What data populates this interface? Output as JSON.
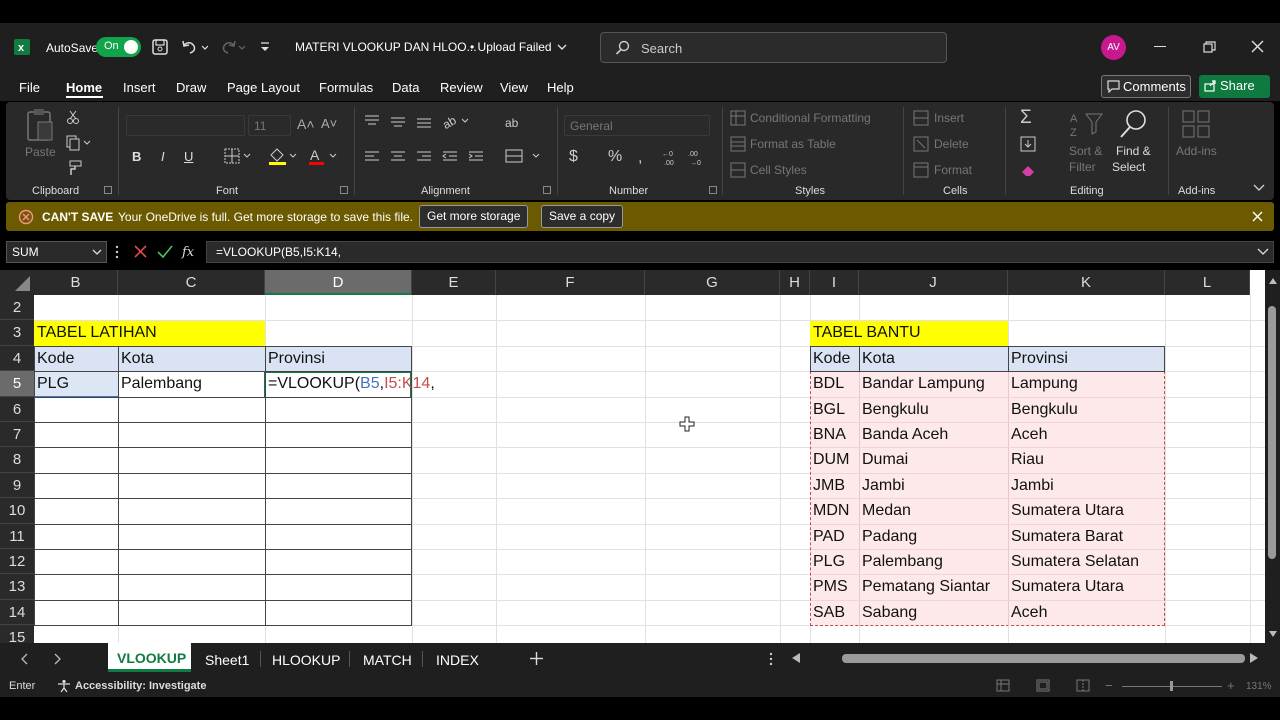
{
  "titlebar": {
    "autosave_label": "AutoSave",
    "toggle_label": "On",
    "document_title": "MATERI VLOOKUP DAN HLOO...",
    "upload_status": "• Upload Failed",
    "search_placeholder": "Search",
    "avatar_initials": "AV"
  },
  "menu": {
    "items": [
      "File",
      "Home",
      "Insert",
      "Draw",
      "Page Layout",
      "Formulas",
      "Data",
      "Review",
      "View",
      "Help"
    ],
    "comments_label": "Comments",
    "share_label": "Share"
  },
  "ribbon": {
    "clipboard": {
      "paste": "Paste",
      "label": "Clipboard"
    },
    "font": {
      "size": "11",
      "label": "Font",
      "bold": "B",
      "italic": "I",
      "underline": "U"
    },
    "alignment": {
      "label": "Alignment"
    },
    "number": {
      "format": "General",
      "label": "Number",
      "currency": "$",
      "percent": "%"
    },
    "styles": {
      "conditional": "Conditional Formatting",
      "table": "Format as Table",
      "cell": "Cell Styles",
      "label": "Styles"
    },
    "cells": {
      "insert": "Insert",
      "delete": "Delete",
      "format": "Format",
      "label": "Cells"
    },
    "editing": {
      "sort_line1": "Sort &",
      "sort_line2": "Filter",
      "find_line1": "Find &",
      "find_line2": "Select",
      "label": "Editing"
    },
    "addins": {
      "label": "Add-ins",
      "button": "Add-ins"
    }
  },
  "message_bar": {
    "title": "CAN'T SAVE",
    "text": "Your OneDrive is full. Get more storage to save this file.",
    "btn_storage": "Get more storage",
    "btn_copy": "Save a copy"
  },
  "formula_bar": {
    "name_box": "SUM",
    "formula": "=VLOOKUP(B5,I5:K14,"
  },
  "grid": {
    "columns": [
      "B",
      "C",
      "D",
      "E",
      "F",
      "G",
      "H",
      "I",
      "J",
      "K",
      "L"
    ],
    "rows": [
      "2",
      "3",
      "4",
      "5",
      "6",
      "7",
      "8",
      "9",
      "10",
      "11",
      "12",
      "13",
      "14",
      "15"
    ],
    "latihan": {
      "title": "TABEL LATIHAN",
      "headers": [
        "Kode",
        "Kota",
        "Provinsi"
      ],
      "row5": [
        "PLG",
        "Palembang"
      ],
      "formula_prefix": "=VLOOKUP(",
      "formula_ref1": "B5",
      "formula_comma1": ",",
      "formula_ref2": "I5:K14",
      "formula_comma2": ","
    },
    "bantu": {
      "title": "TABEL BANTU",
      "headers": [
        "Kode",
        "Kota",
        "Provinsi"
      ],
      "rows": [
        [
          "BDL",
          "Bandar Lampung",
          "Lampung"
        ],
        [
          "BGL",
          "Bengkulu",
          "Bengkulu"
        ],
        [
          "BNA",
          "Banda Aceh",
          "Aceh"
        ],
        [
          "DUM",
          "Dumai",
          "Riau"
        ],
        [
          "JMB",
          "Jambi",
          "Jambi"
        ],
        [
          "MDN",
          "Medan",
          "Sumatera Utara"
        ],
        [
          "PAD",
          "Padang",
          "Sumatera Barat"
        ],
        [
          "PLG",
          "Palembang",
          "Sumatera Selatan"
        ],
        [
          "PMS",
          "Pematang Siantar",
          "Sumatera Utara"
        ],
        [
          "SAB",
          "Sabang",
          "Aceh"
        ]
      ]
    }
  },
  "sheet_tabs": [
    "VLOOKUP",
    "Sheet1",
    "HLOOKUP",
    "MATCH",
    "INDEX"
  ],
  "status": {
    "mode": "Enter",
    "accessibility": "Accessibility: Investigate",
    "zoom": "131%"
  },
  "colors": {
    "yellow_title": "#ffff00",
    "header_fill": "#dae3f3",
    "bantu_fill": "#fde9e9",
    "ref_blue": "#4472c4",
    "ref_red": "#c0504d"
  }
}
